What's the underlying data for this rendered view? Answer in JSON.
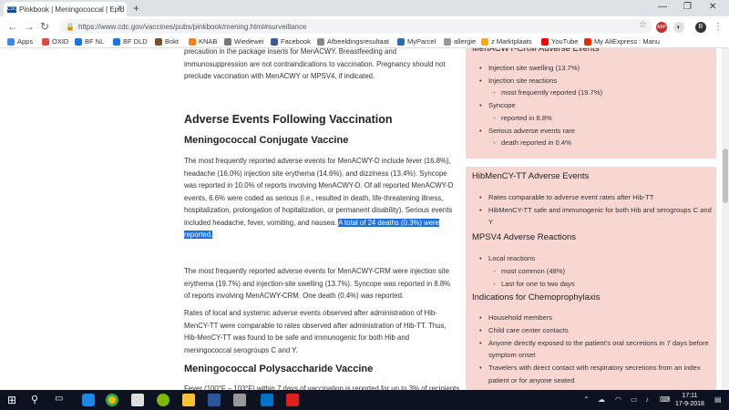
{
  "browser": {
    "tab_title": "Pinkbook | Meningococcal | Epid",
    "tab_favicon_text": "CDC",
    "url": "https://www.cdc.gov/vaccines/pubs/pinkbook/mening.html#surveillance",
    "profile_initial": "B",
    "abp_label": "ABP"
  },
  "bookmarks": [
    {
      "label": "Apps",
      "color": "#4285f4"
    },
    {
      "label": "OXID",
      "color": "#e8453c"
    },
    {
      "label": "BF NL",
      "color": "#1a73e8"
    },
    {
      "label": "BF DLD",
      "color": "#1a73e8"
    },
    {
      "label": "Bokt",
      "color": "#7b4f2c"
    },
    {
      "label": "KNAB",
      "color": "#f58220"
    },
    {
      "label": "Wiedewei",
      "color": "#777777"
    },
    {
      "label": "Facebook",
      "color": "#3b5998"
    },
    {
      "label": "Afbeeldingsresultaat",
      "color": "#888888"
    },
    {
      "label": "MyParcel",
      "color": "#2b6cb0"
    },
    {
      "label": "allergie",
      "color": "#999999"
    },
    {
      "label": "z Marktplaats",
      "color": "#f5a623"
    },
    {
      "label": "YouTube",
      "color": "#ff0000"
    },
    {
      "label": "My AliExpress : Manu",
      "color": "#e62e04"
    }
  ],
  "article": {
    "intro_para": "precaution in the package inserts for MenACWY. Breastfeeding and immunosuppression are not contraindications to vaccination. Pregnancy should not preclude vaccination with MenACWY or MPSV4, if indicated.",
    "h2": "Adverse Events Following Vaccination",
    "h3_conj": "Meningococcal Conjugate Vaccine",
    "para1": "The most frequently reported adverse events for MenACWY-D include fever (16.8%), headache (16.0%) injection site erythema (14.6%), and dizziness (13.4%). Syncope was reported in 10.0% of reports involving MenACWY-D. Of all reported MenACWY-D events, 6.6% were coded as serious (i.e., resulted in death, life-threatening illness, hospitalization, prolongation of hopitalization, or permanent disability). Serious events included headache, fever, vomiting, and nausea.",
    "para1_highlight": "A total of 24 deaths (0.3%) were reported.",
    "para2": "The most frequently reported adverse events for MenACWY-CRM were injection site erythema (19.7%) and injection-site swelling (13.7%). Syncope was reported in 8.8% of reports involving MenACWY-CRM. One death (0.4%) was reported.",
    "para3": "Rates of local and systemic adverse events observed after administration of Hib-MenCY-TT were comparable to rates observed after administration of Hib-TT. Thus, Hib-MenCY-TT was found to be safe and immunogenic for both Hib and meningococcal serogroups C and Y.",
    "h3_poly": "Meningococcal Polysaccharide Vaccine",
    "para4": "Fever (100°F – 103°F) within 7 days of vaccination is reported for up to 3% of recipients"
  },
  "sidebar": {
    "crm_title": "MenACWY-CRM Adverse Events",
    "crm_items": [
      {
        "text": "Injection site swelling (13.7%)",
        "sub": false
      },
      {
        "text": "Injection site reactions",
        "sub": false
      },
      {
        "text": "most frequently reported (19.7%)",
        "sub": true
      },
      {
        "text": "Syncope",
        "sub": false
      },
      {
        "text": "reported in 8.8%",
        "sub": true
      },
      {
        "text": "Serious adverse events rare",
        "sub": false
      },
      {
        "text": "death reported in 0.4%",
        "sub": true
      }
    ],
    "hib_title": "HibMenCY-TT Adverse Events",
    "hib_items": [
      {
        "text": "Rates comparable to adverse event rates after Hib-TT",
        "sub": false
      },
      {
        "text": "HibMenCY-TT safe and immunogenic for both Hib and serogroups C and Y",
        "sub": false
      }
    ],
    "mpsv_title": "MPSV4 Adverse Reactions",
    "mpsv_items": [
      {
        "text": "Local reactions",
        "sub": false
      },
      {
        "text": "most common (48%)",
        "sub": true
      },
      {
        "text": "Last for one to two days",
        "sub": true
      }
    ],
    "chemo_title": "Indications for Chemoprophylaxis",
    "chemo_items": [
      {
        "text": "Household members",
        "sub": false
      },
      {
        "text": "Child care center contacts",
        "sub": false
      },
      {
        "text": "Anyone directly exposed to the patient's oral secretions in 7 days before symptom onset",
        "sub": false
      },
      {
        "text": "Travelers with direct contact with respiratory secretions from an index patient or for anyone seated",
        "sub": false
      }
    ]
  },
  "taskbar": {
    "time": "17:11",
    "date": "17-9-2018"
  }
}
